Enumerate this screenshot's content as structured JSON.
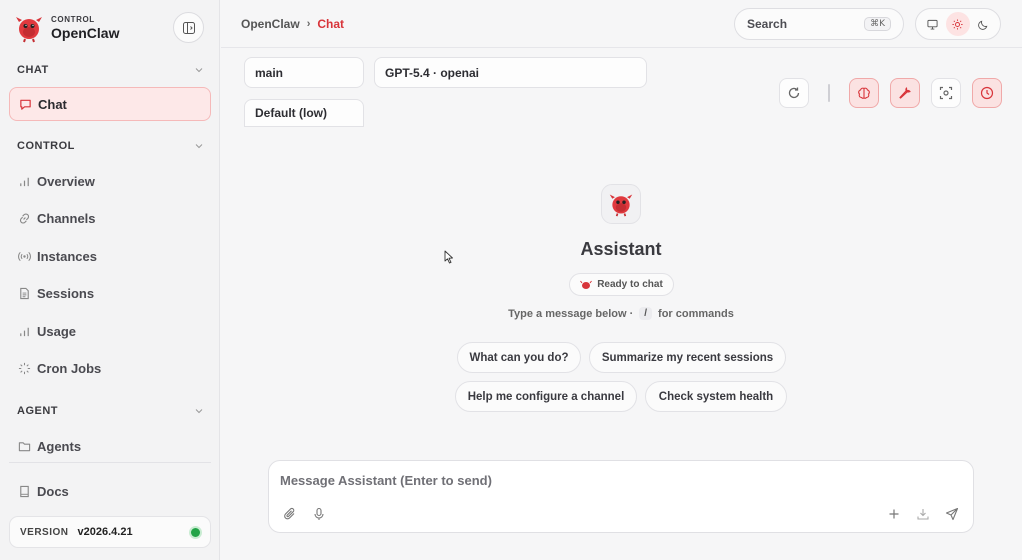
{
  "brand": {
    "small": "CONTROL",
    "name": "OpenClaw"
  },
  "sidebar": {
    "sections": [
      {
        "title": "CHAT",
        "items": [
          {
            "label": "Chat",
            "icon": "chat-bubble-icon",
            "active": true
          }
        ]
      },
      {
        "title": "CONTROL",
        "items": [
          {
            "label": "Overview",
            "icon": "bar-chart-icon"
          },
          {
            "label": "Channels",
            "icon": "link-icon"
          },
          {
            "label": "Instances",
            "icon": "radio-icon"
          },
          {
            "label": "Sessions",
            "icon": "document-icon"
          },
          {
            "label": "Usage",
            "icon": "bar-chart-icon"
          },
          {
            "label": "Cron Jobs",
            "icon": "loader-icon"
          }
        ]
      },
      {
        "title": "AGENT",
        "items": [
          {
            "label": "Agents",
            "icon": "folder-icon"
          }
        ]
      }
    ],
    "docs": "Docs",
    "version_label": "VERSION",
    "version": "v2026.4.21",
    "status_color": "#22a447"
  },
  "topbar": {
    "breadcrumb_root": "OpenClaw",
    "breadcrumb_sep": "›",
    "breadcrumb_current": "Chat",
    "search_label": "Search",
    "search_shortcut": "⌘K"
  },
  "controls": {
    "session": "main",
    "model": "GPT-5.4 · openai",
    "thinking": "Default (low)"
  },
  "center": {
    "name": "Assistant",
    "status": "Ready to chat",
    "hint_before": "Type a message below ·",
    "hint_key": "/",
    "hint_after": "for commands",
    "suggestions": [
      "What can you do?",
      "Summarize my recent sessions",
      "Help me configure a channel",
      "Check system health"
    ]
  },
  "composer": {
    "placeholder": "Message Assistant (Enter to send)"
  },
  "colors": {
    "accent": "#d8343a",
    "accent_bg": "#fde8e8"
  }
}
